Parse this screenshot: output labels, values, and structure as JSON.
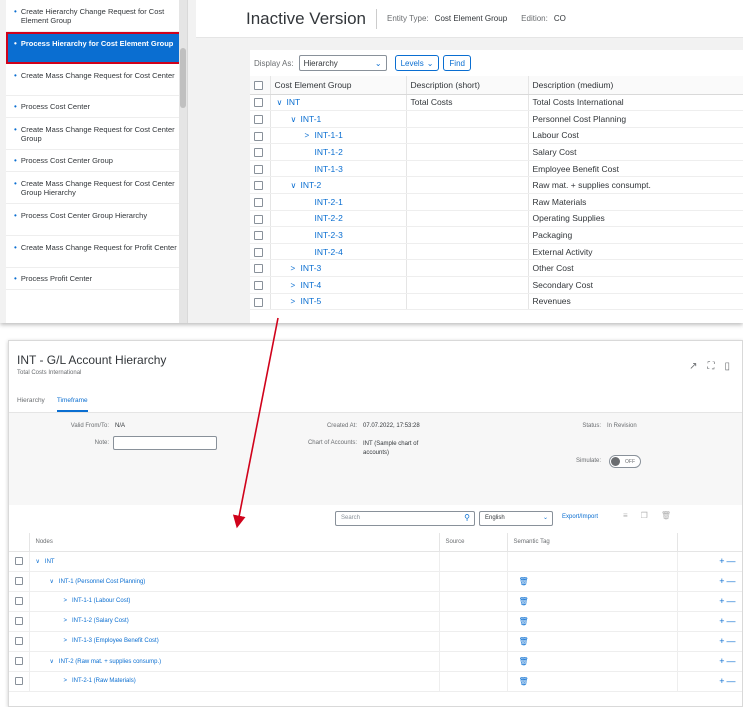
{
  "sidebar": {
    "items": [
      {
        "label": "Create Hierarchy Change Request for Cost Element Group",
        "active": false
      },
      {
        "label": "Process Hierarchy for Cost Element Group",
        "active": true
      },
      {
        "label": "Create Mass Change Request for Cost Center",
        "active": false
      },
      {
        "label": "Process Cost Center",
        "active": false
      },
      {
        "label": "Create Mass Change Request for Cost Center Group",
        "active": false
      },
      {
        "label": "Process Cost Center Group",
        "active": false
      },
      {
        "label": "Create Mass Change Request for Cost Center Group Hierarchy",
        "active": false
      },
      {
        "label": "Process Cost Center Group Hierarchy",
        "active": false
      },
      {
        "label": "Create Mass Change Request for Profit Center",
        "active": false
      },
      {
        "label": "Process Profit Center",
        "active": false
      }
    ]
  },
  "version_header": {
    "title": "Inactive Version",
    "entity_type_label": "Entity Type:",
    "entity_type_value": "Cost Element Group",
    "edition_label": "Edition:",
    "edition_value": "CO"
  },
  "grid_toolbar": {
    "display_as_label": "Display As:",
    "display_as_value": "Hierarchy",
    "levels_label": "Levels",
    "find_label": "Find"
  },
  "grid": {
    "columns": [
      "Cost Element Group",
      "Description (short)",
      "Description (medium)"
    ],
    "rows": [
      {
        "node": "INT",
        "chevron": "down",
        "indent": 0,
        "short": "Total Costs",
        "medium": "Total Costs International"
      },
      {
        "node": "INT-1",
        "chevron": "down",
        "indent": 1,
        "short": "",
        "medium": "Personnel Cost Planning"
      },
      {
        "node": "INT-1-1",
        "chevron": "right",
        "indent": 2,
        "short": "",
        "medium": "Labour Cost"
      },
      {
        "node": "INT-1-2",
        "chevron": "",
        "indent": 2,
        "short": "",
        "medium": "Salary Cost"
      },
      {
        "node": "INT-1-3",
        "chevron": "",
        "indent": 2,
        "short": "",
        "medium": "Employee Benefit Cost"
      },
      {
        "node": "INT-2",
        "chevron": "down",
        "indent": 1,
        "short": "",
        "medium": "Raw mat. + supplies consumpt."
      },
      {
        "node": "INT-2-1",
        "chevron": "",
        "indent": 2,
        "short": "",
        "medium": "Raw Materials"
      },
      {
        "node": "INT-2-2",
        "chevron": "",
        "indent": 2,
        "short": "",
        "medium": "Operating Supplies"
      },
      {
        "node": "INT-2-3",
        "chevron": "",
        "indent": 2,
        "short": "",
        "medium": "Packaging"
      },
      {
        "node": "INT-2-4",
        "chevron": "",
        "indent": 2,
        "short": "",
        "medium": "External Activity"
      },
      {
        "node": "INT-3",
        "chevron": "right",
        "indent": 1,
        "short": "",
        "medium": "Other Cost"
      },
      {
        "node": "INT-4",
        "chevron": "right",
        "indent": 1,
        "short": "",
        "medium": "Secondary Cost"
      },
      {
        "node": "INT-5",
        "chevron": "right",
        "indent": 1,
        "short": "",
        "medium": "Revenues"
      }
    ]
  },
  "hierarchy_page": {
    "title": "INT - G/L Account Hierarchy",
    "subtitle": "Total Costs International",
    "tabs": [
      {
        "label": "Hierarchy",
        "selected": false
      },
      {
        "label": "Timeframe",
        "selected": true
      }
    ],
    "form": {
      "valid_from_label": "Valid From/To:",
      "valid_from_value": "N/A",
      "note_label": "Note:",
      "note_value": "",
      "created_at_label": "Created At:",
      "created_at_value": "07.07.2022, 17:53:28",
      "chart_of_accounts_label": "Chart of Accounts:",
      "chart_of_accounts_value": "INT (Sample chart of accounts)",
      "status_label": "Status:",
      "status_value": "In Revision",
      "simulate_label": "Simulate:",
      "simulate_value": "OFF"
    },
    "toolbar": {
      "search_placeholder": "Search",
      "language": "English",
      "export_import": "Export/Import"
    },
    "columns": [
      "Nodes",
      "Source",
      "Semantic Tag"
    ],
    "rows": [
      {
        "label": "INT",
        "chevron": "down",
        "indent": 0,
        "has_tag": false
      },
      {
        "label": "INT-1 (Personnel Cost Planning)",
        "chevron": "down",
        "indent": 1,
        "has_tag": true
      },
      {
        "label": "INT-1-1 (Labour Cost)",
        "chevron": "right",
        "indent": 2,
        "has_tag": true
      },
      {
        "label": "INT-1-2 (Salary Cost)",
        "chevron": "right",
        "indent": 2,
        "has_tag": true
      },
      {
        "label": "INT-1-3 (Employee Benefit Cost)",
        "chevron": "right",
        "indent": 2,
        "has_tag": true
      },
      {
        "label": "INT-2 (Raw mat. + supplies consump.)",
        "chevron": "down",
        "indent": 1,
        "has_tag": true
      },
      {
        "label": "INT-2-1 (Raw Materials)",
        "chevron": "right",
        "indent": 2,
        "has_tag": true
      }
    ]
  },
  "colors": {
    "accent": "#0a6ed1",
    "highlight_border": "#d0021b",
    "arrow": "#d0021b"
  }
}
